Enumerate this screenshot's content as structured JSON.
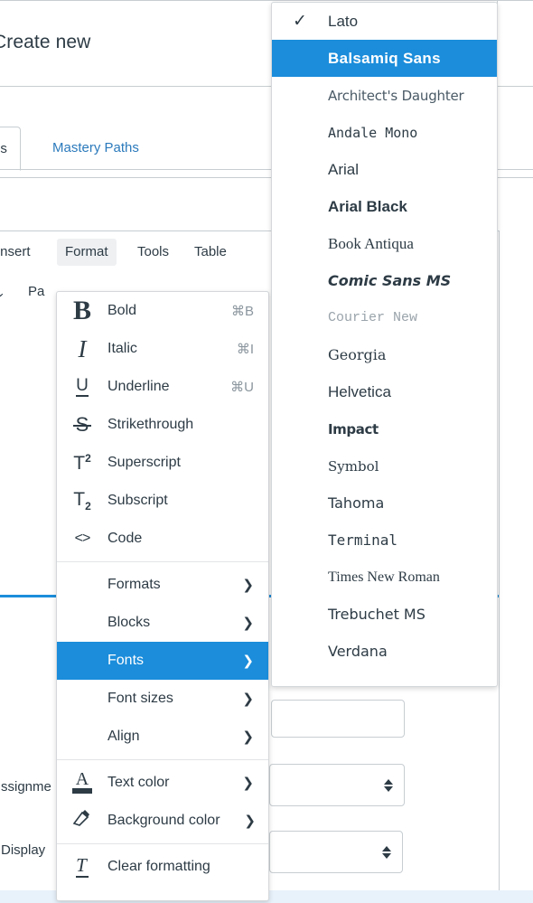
{
  "colors": {
    "accent_blue": "#1b8ddb",
    "link_blue": "#2b7abc",
    "text": "#2d3b45",
    "border": "#c7cdd1",
    "muted": "#8b969e",
    "bottom_band": "#e8f2fb"
  },
  "page": {
    "create_new": "Create new",
    "tabs": [
      {
        "label": "ls",
        "name": "tab-details",
        "active": true
      },
      {
        "label": "Mastery Paths",
        "name": "tab-mastery-paths",
        "active": false
      }
    ],
    "toolbar": {
      "chevron": "⌄",
      "paragraph_label": "Pa",
      "align_icon": "align-lines-icon",
      "align_chevron": "⌄"
    },
    "menubar": [
      {
        "label": "Insert",
        "name": "menubar-insert",
        "selected": false
      },
      {
        "label": "Format",
        "name": "menubar-format",
        "selected": true
      },
      {
        "label": "Tools",
        "name": "menubar-tools",
        "selected": false
      },
      {
        "label": "Table",
        "name": "menubar-table",
        "selected": false
      }
    ],
    "form": {
      "assignment_label": "ssignme",
      "display_label": "Display"
    }
  },
  "format_menu": {
    "groups": [
      {
        "items": [
          {
            "label": "Bold",
            "icon": "bold-icon",
            "shortcut": "⌘B",
            "submenu": false,
            "highlight": false
          },
          {
            "label": "Italic",
            "icon": "italic-icon",
            "shortcut": "⌘I",
            "submenu": false,
            "highlight": false
          },
          {
            "label": "Underline",
            "icon": "underline-icon",
            "shortcut": "⌘U",
            "submenu": false,
            "highlight": false
          },
          {
            "label": "Strikethrough",
            "icon": "strikethrough-icon",
            "shortcut": "",
            "submenu": false,
            "highlight": false
          },
          {
            "label": "Superscript",
            "icon": "superscript-icon",
            "shortcut": "",
            "submenu": false,
            "highlight": false
          },
          {
            "label": "Subscript",
            "icon": "subscript-icon",
            "shortcut": "",
            "submenu": false,
            "highlight": false
          },
          {
            "label": "Code",
            "icon": "code-icon",
            "shortcut": "",
            "submenu": false,
            "highlight": false
          }
        ]
      },
      {
        "items": [
          {
            "label": "Formats",
            "icon": "",
            "shortcut": "",
            "submenu": true,
            "highlight": false
          },
          {
            "label": "Blocks",
            "icon": "",
            "shortcut": "",
            "submenu": true,
            "highlight": false
          },
          {
            "label": "Fonts",
            "icon": "",
            "shortcut": "",
            "submenu": true,
            "highlight": true
          },
          {
            "label": "Font sizes",
            "icon": "",
            "shortcut": "",
            "submenu": true,
            "highlight": false
          },
          {
            "label": "Align",
            "icon": "",
            "shortcut": "",
            "submenu": true,
            "highlight": false
          }
        ]
      },
      {
        "items": [
          {
            "label": "Text color",
            "icon": "text-color-icon",
            "shortcut": "",
            "submenu": true,
            "highlight": false
          },
          {
            "label": "Background color",
            "icon": "background-color-icon",
            "shortcut": "",
            "submenu": true,
            "highlight": false
          }
        ]
      },
      {
        "items": [
          {
            "label": "Clear formatting",
            "icon": "clear-formatting-icon",
            "shortcut": "",
            "submenu": false,
            "highlight": false
          }
        ]
      }
    ],
    "submenu_arrow": "❯"
  },
  "fonts_menu": {
    "check_glyph": "✓",
    "items": [
      {
        "label": "Lato",
        "style": "f-lato",
        "checked": true,
        "highlight": false
      },
      {
        "label": "Balsamiq Sans",
        "style": "f-balsamiq",
        "checked": false,
        "highlight": true
      },
      {
        "label": "Architect's Daughter",
        "style": "f-architect",
        "checked": false,
        "highlight": false
      },
      {
        "label": "Andale Mono",
        "style": "f-andale",
        "checked": false,
        "highlight": false
      },
      {
        "label": "Arial",
        "style": "f-arial",
        "checked": false,
        "highlight": false
      },
      {
        "label": "Arial Black",
        "style": "f-arialblack",
        "checked": false,
        "highlight": false
      },
      {
        "label": "Book Antiqua",
        "style": "f-bookantiqua",
        "checked": false,
        "highlight": false
      },
      {
        "label": "Comic Sans MS",
        "style": "f-comic",
        "checked": false,
        "highlight": false
      },
      {
        "label": "Courier New",
        "style": "f-courier",
        "checked": false,
        "highlight": false
      },
      {
        "label": "Georgia",
        "style": "f-georgia",
        "checked": false,
        "highlight": false
      },
      {
        "label": "Helvetica",
        "style": "f-helvetica",
        "checked": false,
        "highlight": false
      },
      {
        "label": "Impact",
        "style": "f-impact",
        "checked": false,
        "highlight": false
      },
      {
        "label": "Symbol",
        "style": "f-symbol",
        "checked": false,
        "highlight": false
      },
      {
        "label": "Tahoma",
        "style": "f-tahoma",
        "checked": false,
        "highlight": false
      },
      {
        "label": "Terminal",
        "style": "f-terminal",
        "checked": false,
        "highlight": false
      },
      {
        "label": "Times New Roman",
        "style": "f-times",
        "checked": false,
        "highlight": false
      },
      {
        "label": "Trebuchet MS",
        "style": "f-trebuchet",
        "checked": false,
        "highlight": false
      },
      {
        "label": "Verdana",
        "style": "f-verdana",
        "checked": false,
        "highlight": false
      }
    ]
  }
}
